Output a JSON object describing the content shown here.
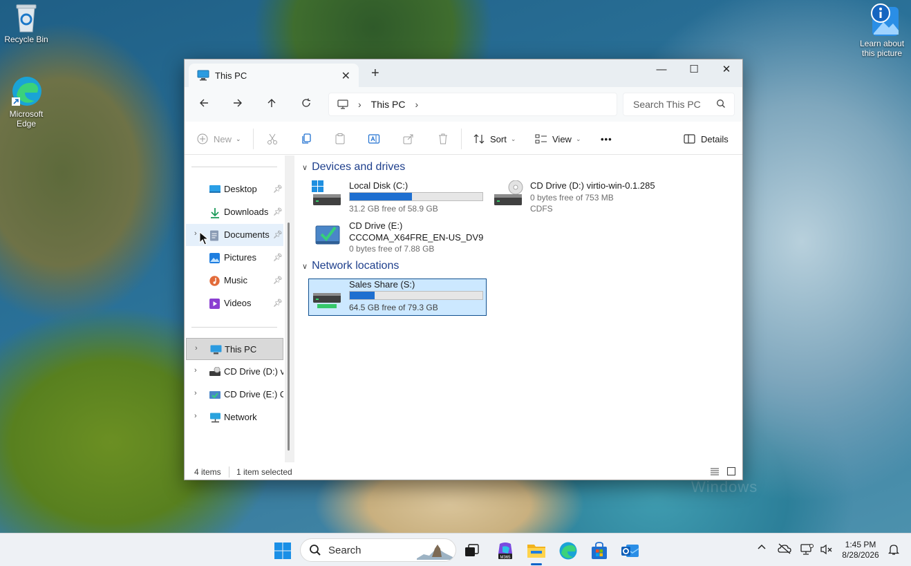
{
  "desktop": {
    "icons": [
      {
        "label": "Recycle Bin"
      },
      {
        "label": "Microsoft\nEdge"
      },
      {
        "label": "Learn about\nthis picture"
      }
    ]
  },
  "window": {
    "tab_title": "This PC",
    "close_tab": "✕",
    "new_tab": "+",
    "minimize": "—",
    "maximize": "☐",
    "close": "✕",
    "address": {
      "crumbs": [
        "This PC"
      ],
      "chevron": "›"
    },
    "search_placeholder": "Search This PC",
    "toolbar": {
      "new_label": "New",
      "sort_label": "Sort",
      "view_label": "View",
      "more_label": "•••",
      "details_label": "Details"
    }
  },
  "navpane": {
    "quick_access": [
      {
        "label": "Desktop",
        "icon": "desktop-icon"
      },
      {
        "label": "Downloads",
        "icon": "downloads-icon"
      },
      {
        "label": "Documents",
        "icon": "documents-icon"
      },
      {
        "label": "Pictures",
        "icon": "pictures-icon"
      },
      {
        "label": "Music",
        "icon": "music-icon"
      },
      {
        "label": "Videos",
        "icon": "videos-icon"
      }
    ],
    "tree": [
      {
        "label": "This PC",
        "icon": "this-pc-icon",
        "selected": true
      },
      {
        "label": "CD Drive (D:) vir",
        "icon": "cd-drive-icon"
      },
      {
        "label": "CD Drive (E:) CC",
        "icon": "cd-drive-icon"
      },
      {
        "label": "Network",
        "icon": "network-icon"
      }
    ]
  },
  "content": {
    "groups": [
      {
        "title": "Devices and drives",
        "drives": [
          {
            "name": "Local Disk (C:)",
            "free_text": "31.2 GB free of 58.9 GB",
            "used_fraction": 0.47
          },
          {
            "name": "CD Drive (D:) virtio-win-0.1.285",
            "free_text": "0 bytes free of 753 MB",
            "fs": "CDFS"
          },
          {
            "name": "CD Drive (E:)",
            "label2": "CCCOMA_X64FRE_EN-US_DV9",
            "free_text": "0 bytes free of 7.88 GB"
          }
        ]
      },
      {
        "title": "Network locations",
        "drives": [
          {
            "name": "Sales Share (S:)",
            "free_text": "64.5 GB free of 79.3 GB",
            "used_fraction": 0.19,
            "selected": true
          }
        ]
      }
    ]
  },
  "statusbar": {
    "items": "4 items",
    "selected": "1 item selected"
  },
  "taskbar": {
    "search_label": "Search",
    "time": "1:45 PM",
    "date": "8/28/2026",
    "tray_up": "^"
  },
  "colors": {
    "accent": "#1e6fd0",
    "selection": "#cce8ff",
    "group_header": "#1e3f8c"
  }
}
